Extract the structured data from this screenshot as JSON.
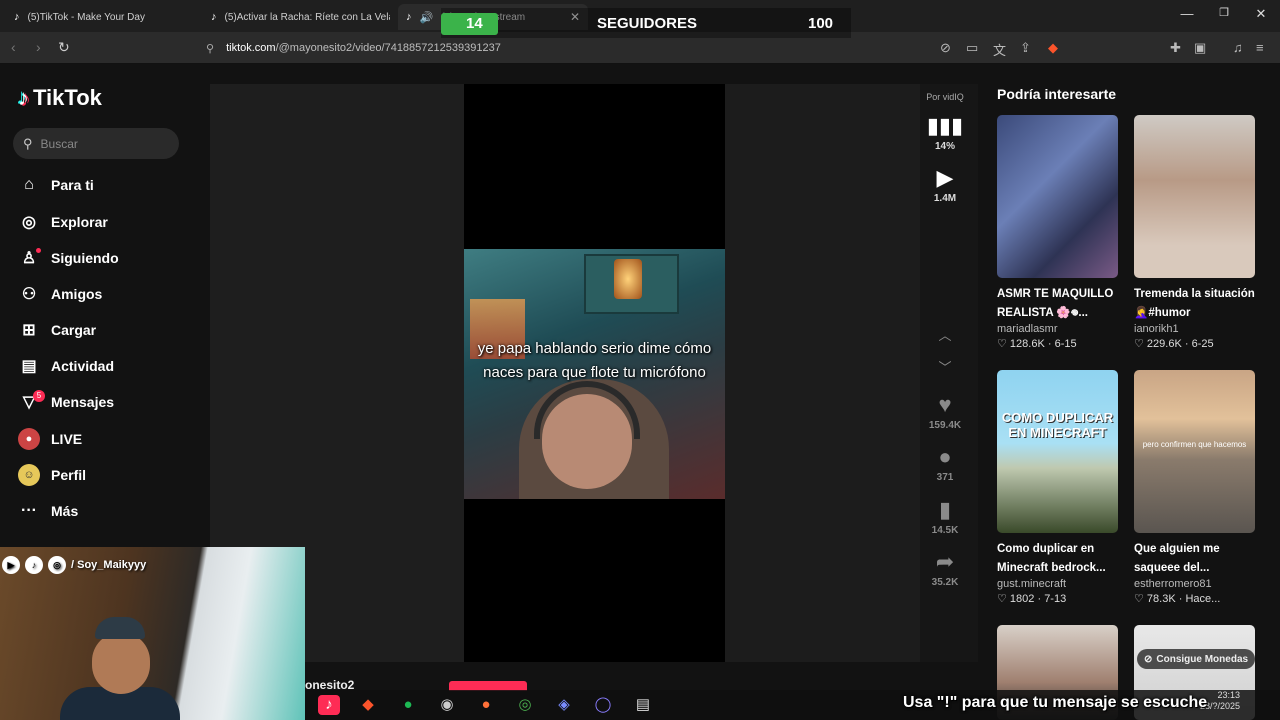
{
  "browser": {
    "tabs": [
      {
        "label": "(5)TikTok - Make Your Day",
        "active": false
      },
      {
        "label": "(5)Activar la Racha: Ríete con La Vela",
        "active": false
      },
      {
        "label": "(5)...ové en stream",
        "active": true
      }
    ],
    "url_domain": "tiktok.com",
    "url_path": "/@mayonesito2/video/7418857212539391237",
    "window_controls": [
      "minimize",
      "maximize",
      "close"
    ]
  },
  "stream_overlay": {
    "count": "14",
    "label": "SEGUIDORES",
    "goal": "100",
    "progress_fraction": 0.14,
    "socials_handle": "/ Soy_Maikyyy",
    "chat_message": "Usa \"!\" para que tu mensaje se escuche",
    "taskbar_time": "23:13",
    "taskbar_date": "28/?/2025"
  },
  "tiktok": {
    "brand": "TikTok",
    "search_placeholder": "Buscar",
    "nav": [
      {
        "label": "Para ti",
        "icon": "home-icon"
      },
      {
        "label": "Explorar",
        "icon": "compass-icon"
      },
      {
        "label": "Siguiendo",
        "icon": "user-follow-icon"
      },
      {
        "label": "Amigos",
        "icon": "friends-icon"
      },
      {
        "label": "Cargar",
        "icon": "upload-icon"
      },
      {
        "label": "Actividad",
        "icon": "activity-icon"
      },
      {
        "label": "Mensajes",
        "icon": "messages-icon",
        "badge": "5"
      },
      {
        "label": "LIVE",
        "icon": "live-icon"
      },
      {
        "label": "Perfil",
        "icon": "profile-icon"
      },
      {
        "label": "Más",
        "icon": "more-icon"
      }
    ],
    "video": {
      "caption_line1": "ye papa hablando serio dime cómo",
      "caption_line2": "naces para que flote tu micrófono",
      "author_partial": "onesito2"
    },
    "vidiq": {
      "label": "Por vidIQ",
      "score": "14%",
      "views": "1.4M"
    },
    "actions": {
      "likes": "159.4K",
      "comments": "371",
      "saves": "14.5K",
      "shares": "35.2K"
    },
    "recommendations_title": "Podría interesarte",
    "recommendations": [
      {
        "title": "ASMR TE MAQUILLO REALISTA 🌸𖦹...",
        "author": "mariadlasmr",
        "likes": "128.6K",
        "date": "6-15"
      },
      {
        "title": "Tremenda la situación 🤦‍♀️#humor",
        "author": "ianorikh1",
        "likes": "229.6K",
        "date": "6-25"
      },
      {
        "title": "Como duplicar en Minecraft bedrock...",
        "author": "gust.minecraft",
        "likes": "1802",
        "date": "7-13",
        "overlay": "COMO DUPLICAR EN MINECRAFT"
      },
      {
        "title": "Que alguien me saqueee del...",
        "author": "estherromero81",
        "likes": "78.3K",
        "date": "Hace...",
        "overlay": "pero confirmen que hacemos"
      }
    ],
    "coins_button": "Consigue Monedas"
  }
}
